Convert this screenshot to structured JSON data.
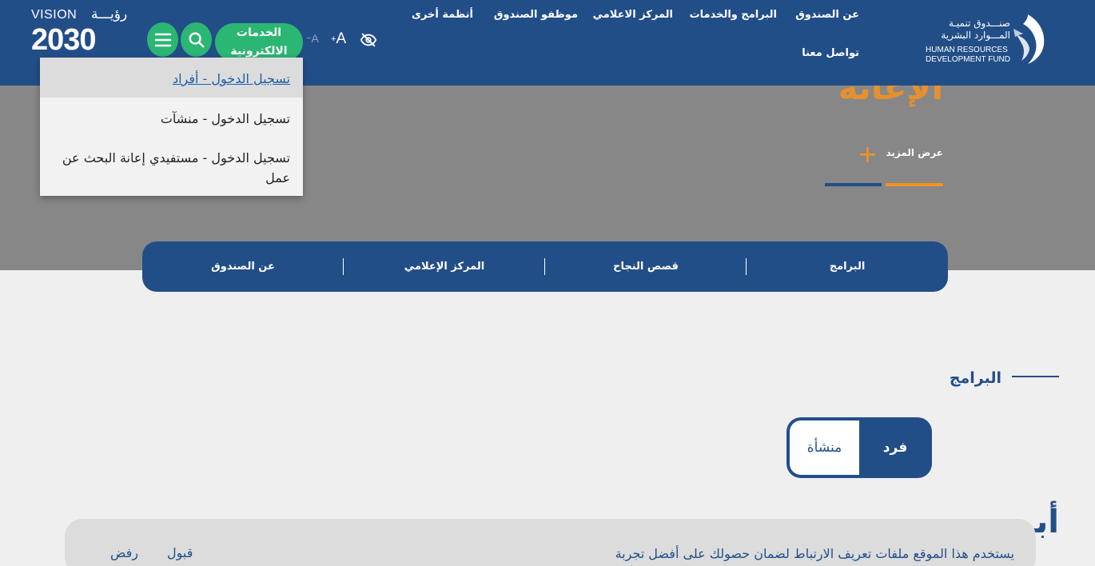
{
  "header": {
    "logo": {
      "ar_line1": "صنـــدوق تنميـة",
      "ar_line2": "المـــوارد البشرية",
      "en_line1": "HUMAN RESOURCES",
      "en_line2": "DEVELOPMENT FUND"
    },
    "nav": {
      "about": "عن الصندوق",
      "programs": "البرامج والخدمات",
      "media": "المركز الاعلامي",
      "employees": "موظفو الصندوق",
      "other": "أنظمة أخرى",
      "contact": "تواصل معنا"
    },
    "font_increase": "A",
    "font_decrease": "A",
    "font_increase_sign": "+",
    "font_decrease_sign": "−",
    "eservices_label_1": "الخدمات",
    "eservices_label_2": "الالكترونية",
    "vision": {
      "word": "VISION",
      "ar": "رؤيـــة",
      "year": "2030"
    },
    "colors": {
      "primary": "#224e88",
      "accent_green": "#2bb673"
    }
  },
  "login_dropdown": {
    "items": [
      "تسجيل الدخول - أفراد",
      "تسجيل الدخول - منشآت",
      "تسجيل الدخول - مستفيدي إعانة البحث عن عمل"
    ]
  },
  "hero": {
    "partial_title": "الإعانة",
    "more_label": "عرض المزيد",
    "colors": {
      "orange": "#f7931e"
    }
  },
  "quick_nav": {
    "items": [
      "البرامج",
      "قصص النجاح",
      "المركز الإعلامي",
      "عن الصندوق"
    ]
  },
  "programs_section": {
    "title": "البرامج",
    "toggle": {
      "individual": "فرد",
      "establishment": "منشأة"
    },
    "partial_heading": "أبـ"
  },
  "cookie_banner": {
    "text": "يستخدم هذا الموقع ملفات تعريف الارتباط لضمان حصولك على أفضل تجربة",
    "accept": "قبول",
    "reject": "رفض"
  }
}
